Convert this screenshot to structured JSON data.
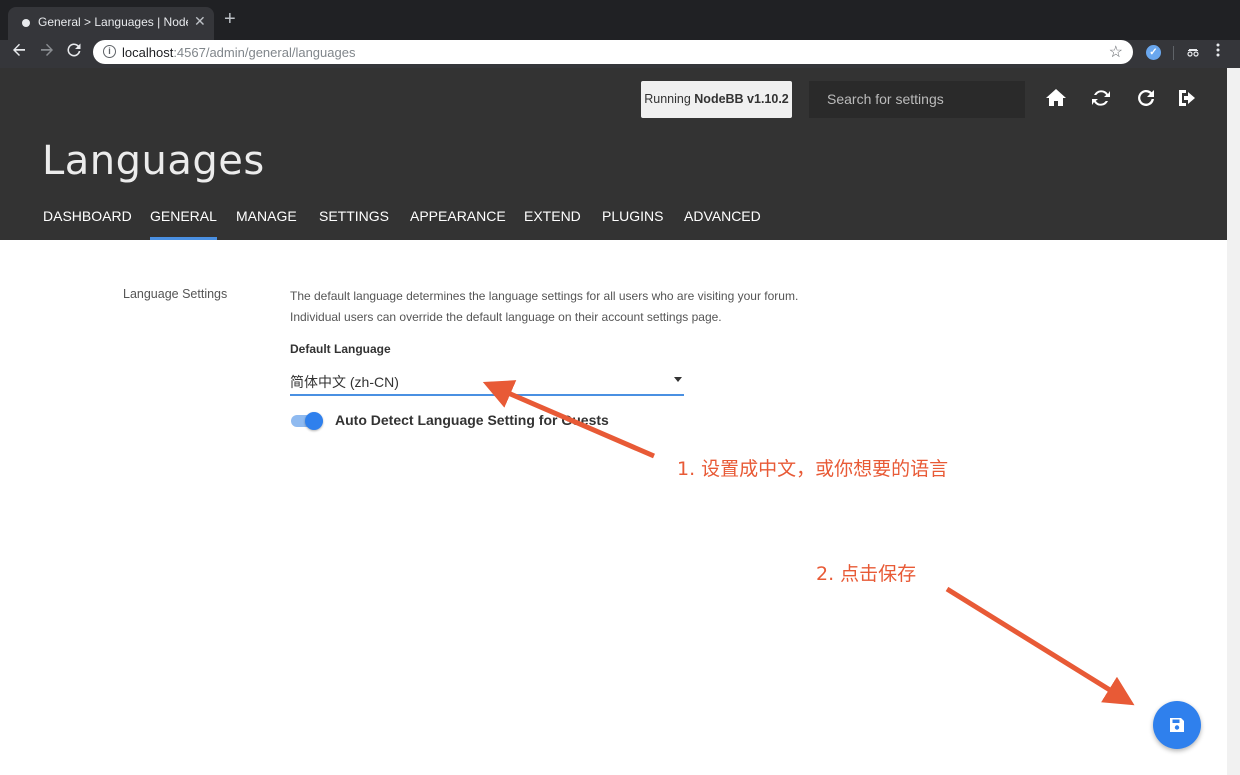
{
  "browser": {
    "tab_title": "General > Languages | NodeBB",
    "tab_close": "✕",
    "new_tab": "+",
    "url_host": "localhost",
    "url_path": ":4567/admin/general/languages"
  },
  "header": {
    "running_prefix": "Running ",
    "running_version": "NodeBB v1.10.2",
    "search_placeholder": "Search for settings",
    "page_title": "Languages",
    "icons": [
      "home-icon",
      "sync-icon",
      "refresh-icon",
      "logout-icon"
    ]
  },
  "nav": {
    "items": [
      {
        "label": "DASHBOARD"
      },
      {
        "label": "GENERAL",
        "active": true
      },
      {
        "label": "MANAGE"
      },
      {
        "label": "SETTINGS"
      },
      {
        "label": "APPEARANCE"
      },
      {
        "label": "EXTEND"
      },
      {
        "label": "PLUGINS"
      },
      {
        "label": "ADVANCED"
      }
    ]
  },
  "content": {
    "section_label": "Language Settings",
    "description_line1": "The default language determines the language settings for all users who are visiting your forum.",
    "description_line2": "Individual users can override the default language on their account settings page.",
    "field_label": "Default Language",
    "selected_language": "简体中文 (zh-CN)",
    "toggle_label": "Auto Detect Language Setting for Guests",
    "toggle_on": true
  },
  "annotations": {
    "step1": "1. 设置成中文，或你想要的语言",
    "step2": "2. 点击保存"
  },
  "colors": {
    "accent": "#2f80ed",
    "header_bg": "#333333",
    "annotation": "#e85a36"
  }
}
